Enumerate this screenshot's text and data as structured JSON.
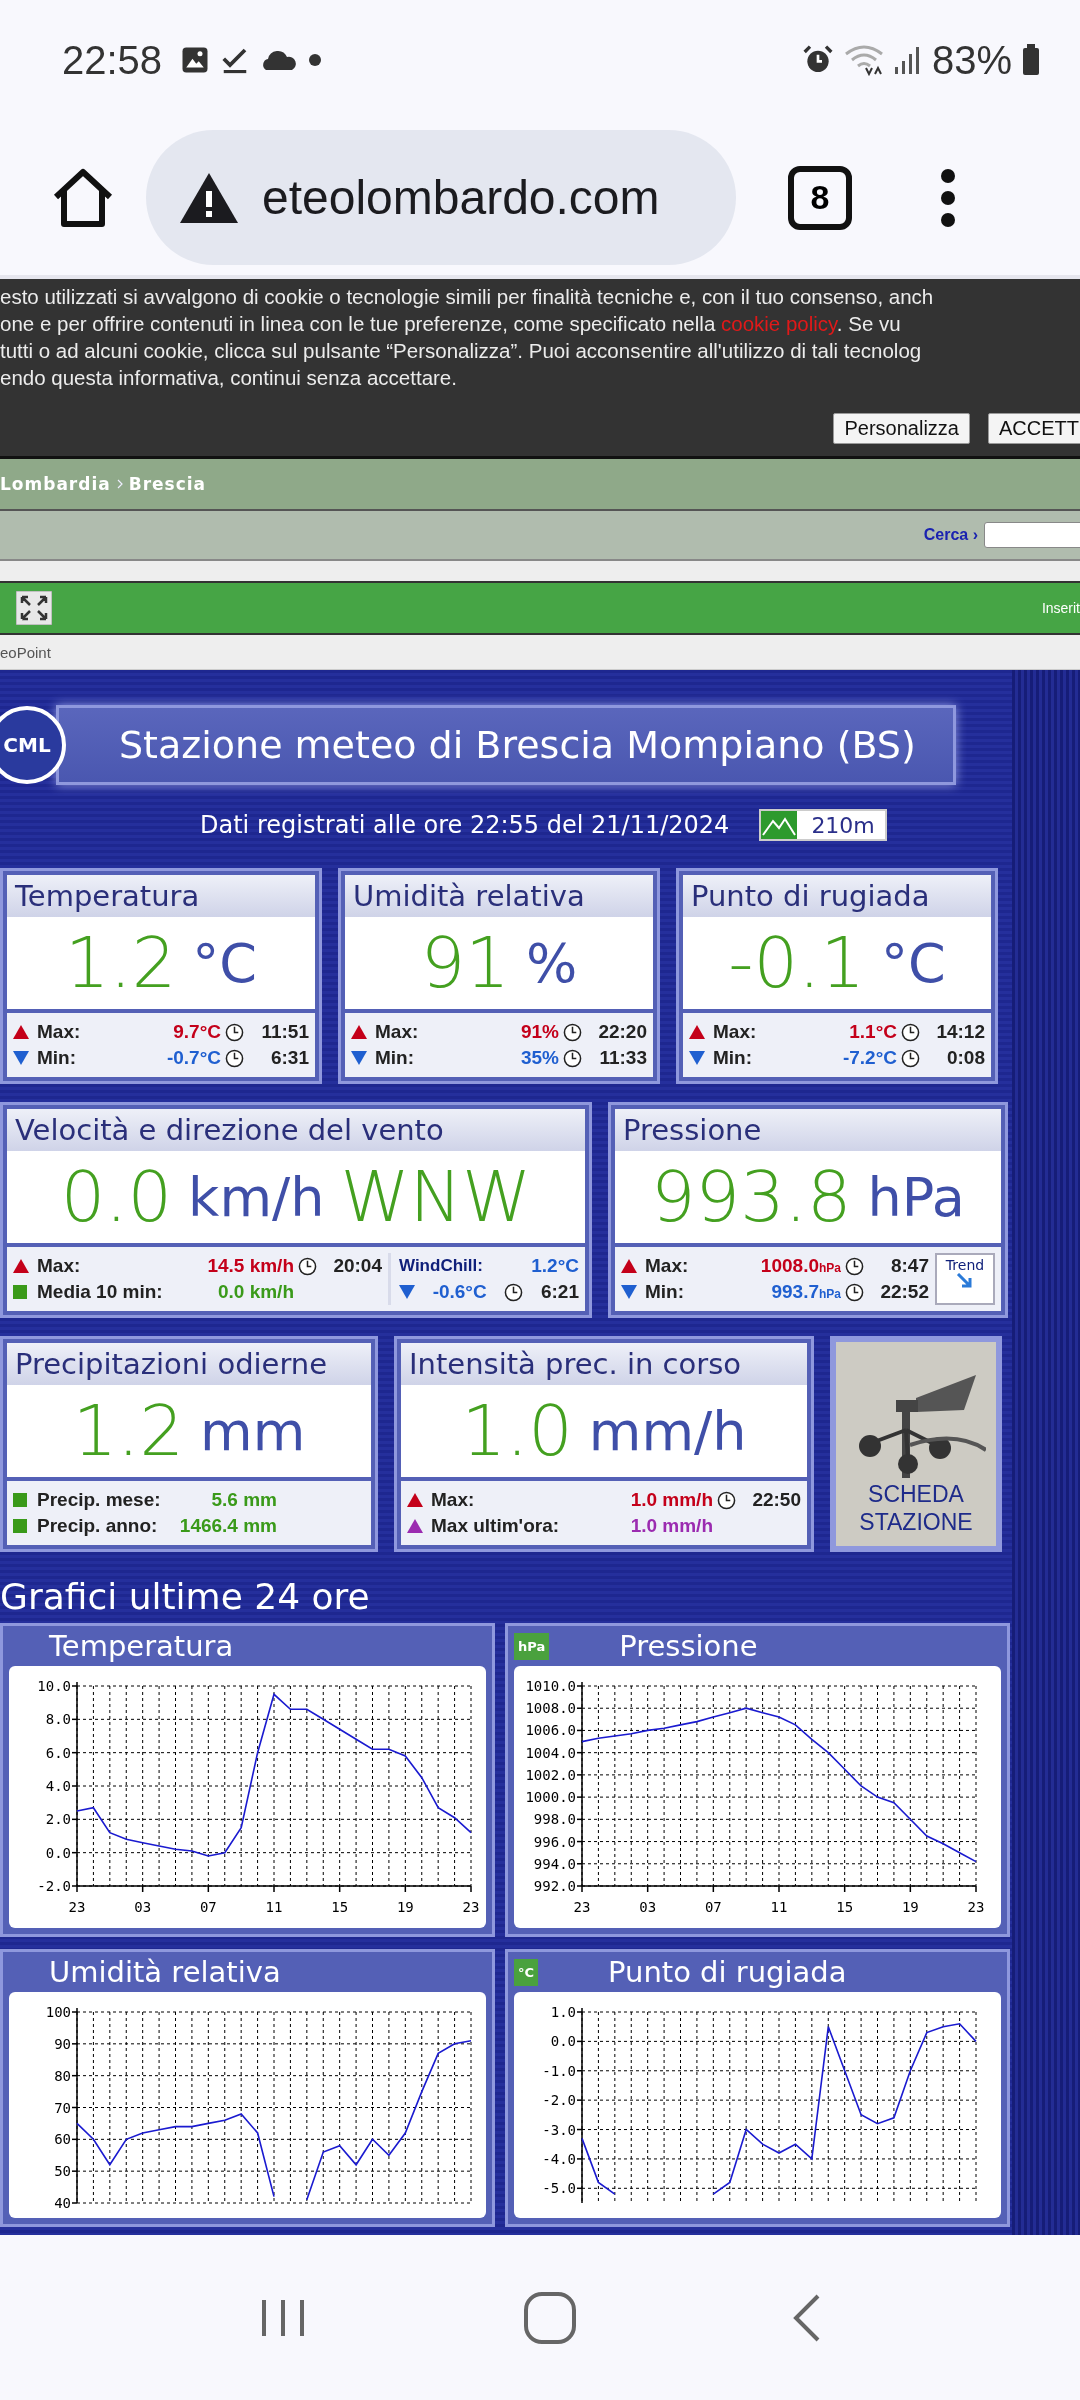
{
  "status_bar": {
    "time": "22:58",
    "battery": "83%"
  },
  "browser": {
    "url": "eteolombardo.com",
    "tab_count": "8"
  },
  "cookie_banner": {
    "lines": [
      {
        "text": "esto utilizzati si avvalgono di cookie o tecnologie simili per finalità tecniche e, con il tuo consenso, anch"
      },
      {
        "text": "one e per offrire contenuti in linea con le tue preferenze, come specificato nella ",
        "link": "cookie policy",
        "after": ". Se vu"
      },
      {
        "text": "tutti o ad alcuni cookie, clicca sul pulsante “Personalizza”. Puoi acconsentire all'utilizzo di tali tecnolog"
      },
      {
        "text": "endo questa informativa, continui senza accettare."
      }
    ],
    "buttons": [
      "Personalizza",
      "ACCETT"
    ]
  },
  "breadcrumb": [
    "Lombardia",
    "Brescia"
  ],
  "search": {
    "label": "Cerca ›"
  },
  "toolbar": {
    "right_text": "Inserit"
  },
  "subnav": "eoPoint",
  "station": {
    "logo_text": "CML",
    "title": "Stazione meteo di Brescia Mompiano (BS)",
    "updated": "Dati registrati alle ore 22:55 del 21/11/2024",
    "elevation": "210m"
  },
  "rows": [
    [
      {
        "kind": "reading",
        "title": "Temperatura",
        "value": "1.2",
        "unit": "°C",
        "stats": [
          {
            "kind": "max",
            "label": "Max:",
            "value": "9.7°C",
            "time": "11:51"
          },
          {
            "kind": "min",
            "label": "Min:",
            "value": "-0.7°C",
            "time": "6:31"
          }
        ]
      },
      {
        "kind": "reading",
        "title": "Umidità relativa",
        "value": "91",
        "unit": "%",
        "stats": [
          {
            "kind": "max",
            "label": "Max:",
            "value": "91%",
            "time": "22:20"
          },
          {
            "kind": "min",
            "label": "Min:",
            "value": "35%",
            "time": "11:33"
          }
        ]
      },
      {
        "kind": "reading",
        "title": "Punto di rugiada",
        "value": "-0.1",
        "unit": "°C",
        "stats": [
          {
            "kind": "max",
            "label": "Max:",
            "value": "1.1°C",
            "time": "14:12"
          },
          {
            "kind": "min",
            "label": "Min:",
            "value": "-7.2°C",
            "time": "0:08"
          }
        ]
      }
    ],
    [
      {
        "kind": "reading",
        "title": "Velocità e direzione del vento",
        "value": "0.0",
        "unit": "km/h",
        "direction": "WNW",
        "stats": [
          {
            "kind": "max",
            "label": "Max:",
            "value": "14.5 km/h",
            "time": "20:04"
          },
          {
            "kind": "avg",
            "label": "Media 10 min:",
            "value": "0.0 km/h"
          }
        ],
        "side": {
          "label": "WindChill:",
          "value": "1.2°C",
          "min": {
            "kind": "min",
            "value": "-0.6°C",
            "time": "6:21"
          }
        }
      },
      {
        "kind": "reading",
        "title": "Pressione",
        "value": "993.8",
        "unit": "hPa",
        "stats": [
          {
            "kind": "max",
            "label": "Max:",
            "value": "1008.0",
            "small_unit": "hPa",
            "time": "8:47"
          },
          {
            "kind": "min",
            "label": "Min:",
            "value": "993.7",
            "small_unit": "hPa",
            "time": "22:52"
          }
        ],
        "trend": {
          "label": "Trend"
        }
      }
    ],
    [
      {
        "kind": "reading",
        "title": "Precipitazioni odierne",
        "value": "1.2",
        "unit": "mm",
        "stats": [
          {
            "kind": "avg",
            "label": "Precip. mese:",
            "value": "5.6 mm"
          },
          {
            "kind": "avg",
            "label": "Precip. anno:",
            "value": "1466.4 mm"
          }
        ]
      },
      {
        "kind": "reading",
        "title": "Intensità prec. in corso",
        "value": "1.0",
        "unit": "mm/h",
        "stats": [
          {
            "kind": "max",
            "label": "Max:",
            "value": "1.0 mm/h",
            "time": "22:50"
          },
          {
            "kind": "hourmax",
            "label": "Max ultim'ora:",
            "value": "1.0 mm/h"
          }
        ]
      },
      {
        "kind": "station",
        "label": "SCHEDA STAZIONE"
      }
    ]
  ],
  "charts_heading": "Grafici ultime 24 ore",
  "charts": [
    {
      "title": "Temperatura",
      "chart_data": {
        "type": "line",
        "grid": true,
        "categories": [
          "23",
          null,
          null,
          null,
          "03",
          null,
          null,
          null,
          "07",
          null,
          null,
          null,
          "11",
          null,
          null,
          null,
          "15",
          null,
          null,
          null,
          "19",
          null,
          null,
          null,
          "23"
        ],
        "ylim": [
          -2,
          10
        ],
        "yticks": [
          {
            "value": -2,
            "label": "-2.0"
          },
          {
            "value": 0,
            "label": "0.0"
          },
          {
            "value": 2,
            "label": "2.0"
          },
          {
            "value": 4,
            "label": "4.0"
          },
          {
            "value": 6,
            "label": "6.0"
          },
          {
            "value": 8,
            "label": "8.0"
          },
          {
            "value": 10,
            "label": "10.0"
          }
        ],
        "series": [
          {
            "color": "#1a1ad0",
            "values": [
              2.5,
              2.7,
              1.2,
              0.8,
              0.6,
              0.4,
              0.2,
              0.1,
              -0.2,
              0.0,
              1.5,
              6.0,
              9.5,
              8.6,
              8.6,
              8.0,
              7.4,
              6.8,
              6.2,
              6.2,
              5.8,
              4.5,
              2.7,
              2.1,
              1.2
            ]
          }
        ]
      }
    },
    {
      "title": "Pressione",
      "badge": "hPa",
      "chart_data": {
        "type": "line",
        "grid": true,
        "categories": [
          "23",
          null,
          null,
          null,
          "03",
          null,
          null,
          null,
          "07",
          null,
          null,
          null,
          "11",
          null,
          null,
          null,
          "15",
          null,
          null,
          null,
          "19",
          null,
          null,
          null,
          "23"
        ],
        "ylim": [
          992,
          1010
        ],
        "yticks": [
          {
            "value": 992,
            "label": "992.0"
          },
          {
            "value": 994,
            "label": "994.0"
          },
          {
            "value": 996,
            "label": "996.0"
          },
          {
            "value": 998,
            "label": "998.0"
          },
          {
            "value": 1000,
            "label": "1000.0"
          },
          {
            "value": 1002,
            "label": "1002.0"
          },
          {
            "value": 1004,
            "label": "1004.0"
          },
          {
            "value": 1006,
            "label": "1006.0"
          },
          {
            "value": 1008,
            "label": "1008.0"
          },
          {
            "value": 1010,
            "label": "1010.0"
          }
        ],
        "series": [
          {
            "color": "#1a1ad0",
            "values": [
              1005,
              1005.3,
              1005.5,
              1005.7,
              1006,
              1006.2,
              1006.5,
              1006.8,
              1007.2,
              1007.6,
              1008,
              1007.6,
              1007.2,
              1006.5,
              1005.2,
              1004,
              1002.5,
              1001,
              1000,
              999.5,
              998,
              996.5,
              995.8,
              995,
              994.2
            ]
          }
        ]
      }
    },
    {
      "title": "Umidità relativa",
      "chart_data": {
        "type": "line",
        "grid": true,
        "categories": [
          null,
          null,
          null,
          null,
          null,
          null,
          null,
          null,
          null,
          null,
          null,
          null,
          null,
          null,
          null,
          null,
          null,
          null,
          null,
          null,
          null,
          null,
          null,
          null,
          null
        ],
        "ylim": [
          40,
          100
        ],
        "yticks": [
          40,
          50,
          60,
          70,
          80,
          90,
          100
        ],
        "series": [
          {
            "color": "#1a1ad0",
            "values": [
              65,
              60,
              52,
              60,
              62,
              63,
              64,
              64,
              65,
              66,
              68,
              62,
              42,
              null,
              41,
              56,
              58,
              52,
              60,
              55,
              62,
              75,
              87,
              90,
              91
            ]
          }
        ]
      }
    },
    {
      "title": "Punto di rugiada",
      "badge": "°C",
      "chart_data": {
        "type": "line",
        "grid": true,
        "categories": [
          null,
          null,
          null,
          null,
          null,
          null,
          null,
          null,
          null,
          null,
          null,
          null,
          null,
          null,
          null,
          null,
          null,
          null,
          null,
          null,
          null,
          null,
          null,
          null,
          null
        ],
        "ylim": [
          -5.5,
          1
        ],
        "yticks": [
          {
            "value": -5,
            "label": "-5.0"
          },
          {
            "value": -4,
            "label": "-4.0"
          },
          {
            "value": -3,
            "label": "-3.0"
          },
          {
            "value": -2,
            "label": "-2.0"
          },
          {
            "value": -1,
            "label": "-1.0"
          },
          {
            "value": 0,
            "label": "0.0"
          },
          {
            "value": 1,
            "label": "1.0"
          }
        ],
        "series": [
          {
            "color": "#1a1ad0",
            "values": [
              -3.3,
              -4.8,
              -5.2,
              null,
              null,
              null,
              null,
              null,
              -5.2,
              -4.8,
              -3,
              -3.5,
              -3.8,
              -3.5,
              -4,
              0.5,
              -1,
              -2.5,
              -2.8,
              -2.6,
              -1,
              0.3,
              0.5,
              0.6,
              0
            ]
          }
        ]
      }
    }
  ]
}
